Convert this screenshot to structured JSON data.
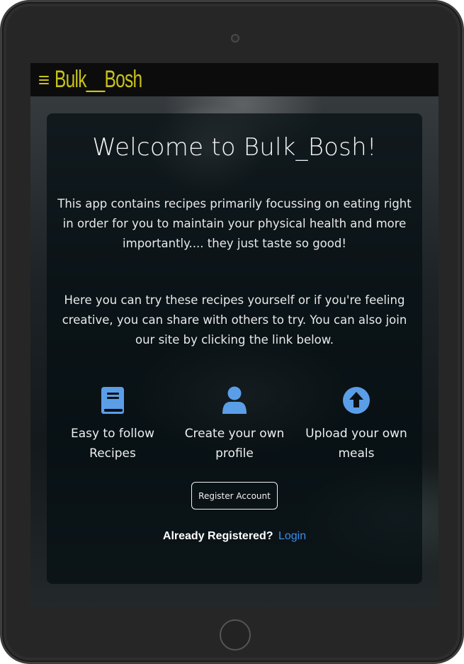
{
  "navbar": {
    "brand": "Bulk__Bosh",
    "brand_color": "#c8c21a"
  },
  "hero": {
    "title": "Welcome to Bulk_Bosh!",
    "paragraph_1": "This app contains recipes primarily focussing on eating right in order for you to maintain your physical health and more importantly.... they just taste so good!",
    "paragraph_2": "Here you can try these recipes yourself or if you're feeling creative, you can share with others to try. You can also join our site by clicking the link below."
  },
  "features": [
    {
      "icon": "book-icon",
      "label": "Easy to follow Recipes"
    },
    {
      "icon": "user-icon",
      "label": "Create your own profile"
    },
    {
      "icon": "upload-arrow-icon",
      "label": "Upload your own meals"
    }
  ],
  "icon_color": "#5b9ee8",
  "register_button": {
    "label": "Register Account"
  },
  "login": {
    "prompt": "Already Registered?",
    "link_label": "Login",
    "link_color": "#3b8eea"
  }
}
